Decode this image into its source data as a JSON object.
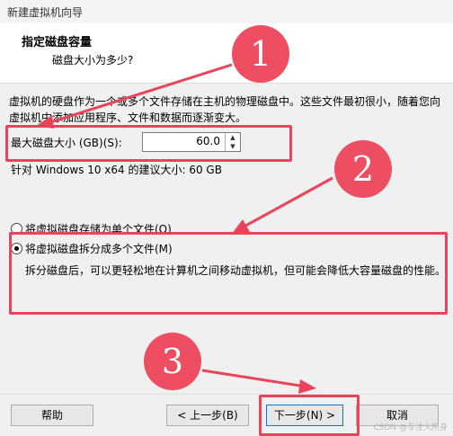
{
  "window": {
    "title": "新建虚拟机向导"
  },
  "header": {
    "title": "指定磁盘容量",
    "subtitle": "磁盘大小为多少?"
  },
  "description": "虚拟机的硬盘作为一个或多个文件存储在主机的物理磁盘中。这些文件最初很小，随着您向虚拟机中添加应用程序、文件和数据而逐渐变大。",
  "disk_size": {
    "label": "最大磁盘大小 (GB)(S):",
    "value": "60.0"
  },
  "recommended": "针对 Windows 10 x64 的建议大小: 60 GB",
  "storage_options": [
    {
      "label": "将虚拟磁盘存储为单个文件(O)",
      "selected": false
    },
    {
      "label": "将虚拟磁盘拆分成多个文件(M)",
      "selected": true
    }
  ],
  "split_description": "拆分磁盘后，可以更轻松地在计算机之间移动虚拟机，但可能会降低大容量磁盘的性能。",
  "buttons": {
    "help": "帮助",
    "back": "< 上一步(B)",
    "next": "下一步(N) >",
    "cancel": "取消"
  },
  "annotations": {
    "badge1": "1",
    "badge2": "2",
    "badge3": "3",
    "color": "#e8455b"
  },
  "watermark": "CSDN @专注大所身"
}
